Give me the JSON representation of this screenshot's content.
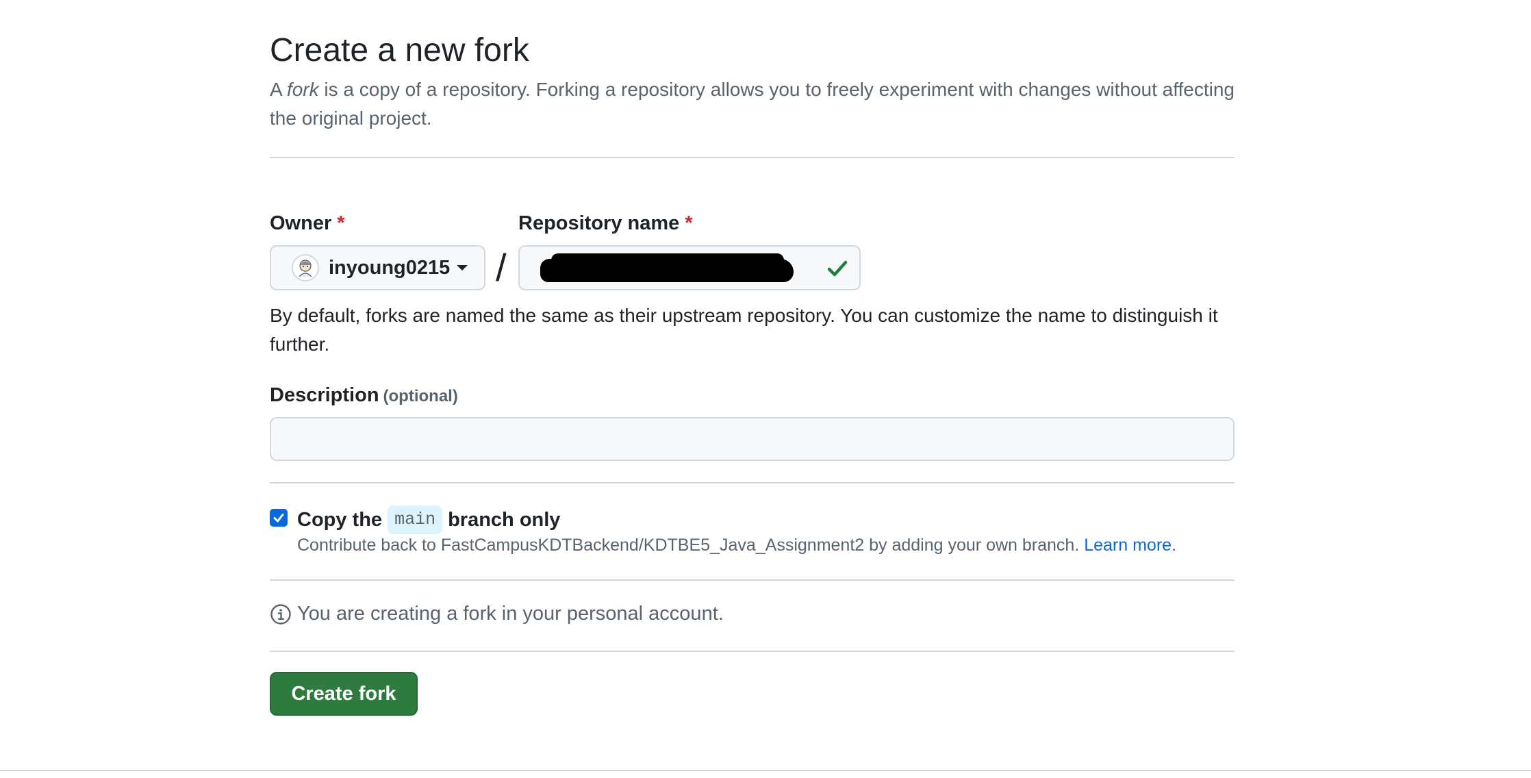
{
  "page": {
    "title": "Create a new fork",
    "subtitle_prefix": "A ",
    "subtitle_em": "fork",
    "subtitle_rest": " is a copy of a repository. Forking a repository allows you to freely experiment with changes without affecting the original project."
  },
  "owner": {
    "label": "Owner",
    "required_mark": "*",
    "selected": "inyoung0215"
  },
  "separator": "/",
  "repository": {
    "label": "Repository name",
    "required_mark": "*",
    "value_redacted": true,
    "valid": true
  },
  "help_text": "By default, forks are named the same as their upstream repository. You can customize the name to distinguish it further.",
  "description": {
    "label": "Description",
    "optional": "(optional)",
    "value": ""
  },
  "copy_branch": {
    "checked": true,
    "label_prefix": "Copy the",
    "branch": "main",
    "label_suffix": "branch only",
    "hint": "Contribute back to FastCampusKDTBackend/KDTBE5_Java_Assignment2 by adding your own branch.",
    "link": "Learn more."
  },
  "info": {
    "text": "You are creating a fork in your personal account."
  },
  "actions": {
    "create_label": "Create fork"
  },
  "colors": {
    "primary_button": "#2f7a3f",
    "link": "#0969da",
    "required": "#d1242f",
    "check": "#1a7f37"
  }
}
